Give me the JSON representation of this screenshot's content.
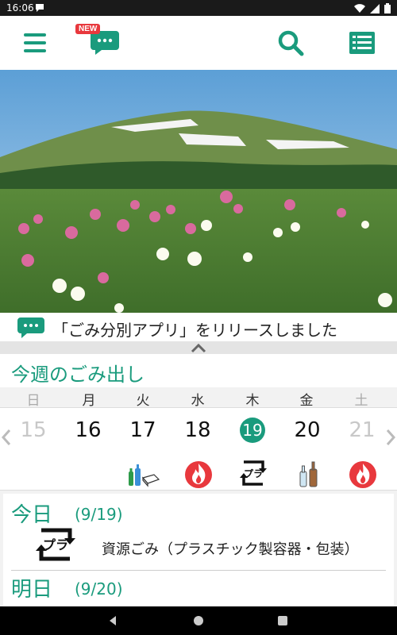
{
  "status_bar": {
    "time": "16:06"
  },
  "app_bar": {
    "new_badge": "NEW",
    "icons": [
      "hamburger-menu-icon",
      "chat-bubble-icon",
      "search-icon",
      "list-icon"
    ],
    "accent": "#1a9b7d"
  },
  "news": {
    "text": "「ごみ分別アプリ」をリリースしました"
  },
  "week": {
    "title": "今週のごみ出し",
    "weekdays": [
      "日",
      "月",
      "火",
      "水",
      "木",
      "金",
      "土"
    ],
    "days": [
      {
        "num": "15",
        "state": "off",
        "icon": ""
      },
      {
        "num": "16",
        "state": "normal",
        "icon": ""
      },
      {
        "num": "17",
        "state": "normal",
        "icon": "bottles-and-pack-icon"
      },
      {
        "num": "18",
        "state": "normal",
        "icon": "burnable-fire-icon"
      },
      {
        "num": "19",
        "state": "today",
        "icon": "plastic-recycle-icon"
      },
      {
        "num": "20",
        "state": "normal",
        "icon": "glass-bottles-icon"
      },
      {
        "num": "21",
        "state": "off",
        "icon": "burnable-fire-icon"
      }
    ]
  },
  "today": {
    "label": "今日",
    "date": "(9/19)",
    "desc": "資源ごみ（プラスチック製容器・包装）"
  },
  "tomorrow": {
    "label": "明日",
    "date": "(9/20)"
  },
  "colors": {
    "accent": "#1a9b7d",
    "fire": "#e8383d",
    "badge": "#e8383d"
  }
}
